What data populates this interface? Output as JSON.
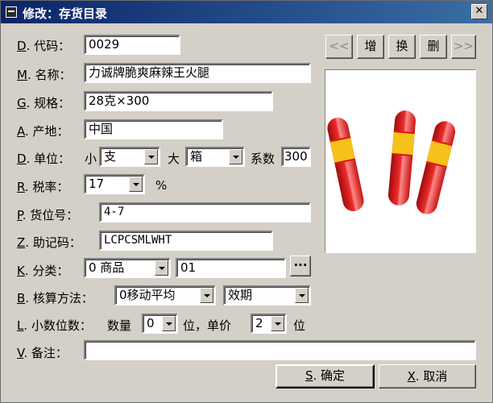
{
  "window": {
    "title": "修改：存货目录",
    "close_label": "✕"
  },
  "form": {
    "code": {
      "hotkey": "D",
      "label": ". 代码：",
      "value": "0029"
    },
    "name": {
      "hotkey": "M",
      "label": ". 名称：",
      "value": "力诚牌脆爽麻辣王火腿"
    },
    "spec": {
      "hotkey": "G",
      "label": ". 规格：",
      "value": "28克×300"
    },
    "origin": {
      "hotkey": "A",
      "label": ". 产地：",
      "value": "中国"
    },
    "unit": {
      "hotkey": "D",
      "label": ". 单位：",
      "small_label": "小",
      "small_value": "支",
      "large_label": "大",
      "large_value": "箱",
      "factor_label": "系数",
      "factor_value": "300"
    },
    "tax": {
      "hotkey": "R",
      "label": ". 税率：",
      "value": "17",
      "unit": "%"
    },
    "location": {
      "hotkey": "P",
      "label": ". 货位号：",
      "value": "4-7"
    },
    "mnemonic": {
      "hotkey": "Z",
      "label": ". 助记码：",
      "value": "LCPCSMLWHT"
    },
    "category": {
      "hotkey": "K",
      "label": ". 分类：",
      "value": "0 商品",
      "code_value": "01",
      "browse_label": "···"
    },
    "costing": {
      "hotkey": "B",
      "label": ". 核算方法：",
      "method_value": "0移动平均",
      "period_value": "效期"
    },
    "decimals": {
      "hotkey": "L",
      "label": ". 小数位数：",
      "qty_label": "数量",
      "qty_value": "0",
      "mid_label": "位，单价",
      "price_value": "2",
      "end_label": "位"
    },
    "remark": {
      "hotkey": "V",
      "label": ". 备注：",
      "value": ""
    }
  },
  "toolbar": {
    "prev_label": "<<",
    "add_label": "增",
    "replace_label": "换",
    "delete_label": "删",
    "next_label": ">>"
  },
  "buttons": {
    "ok_hotkey": "S",
    "ok_label": ". 确定",
    "cancel_hotkey": "X",
    "cancel_label": ". 取消"
  },
  "colors": {
    "titlebar": "#0a246a",
    "face": "#d4d0c8"
  }
}
